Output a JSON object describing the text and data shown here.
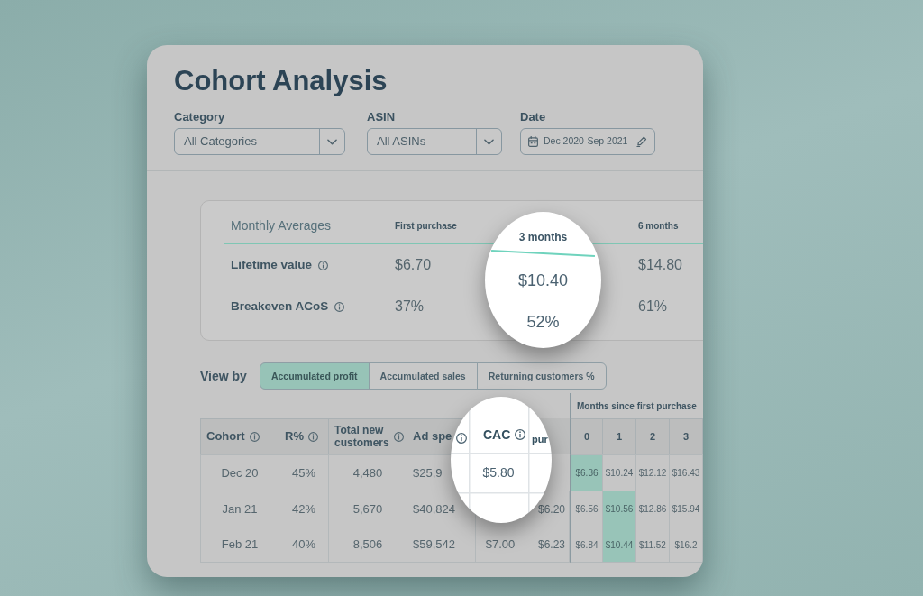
{
  "page": {
    "title": "Cohort Analysis"
  },
  "filters": [
    {
      "kind": "select",
      "label": "Category",
      "value": "All Categories"
    },
    {
      "kind": "select",
      "label": "ASIN",
      "value": "All ASINs"
    },
    {
      "kind": "date",
      "label": "Date",
      "value": "Dec 2020-Sep 2021"
    }
  ],
  "monthly_averages": {
    "title": "Monthly Averages",
    "columns": [
      {
        "label": "First purchase",
        "in_lens": false
      },
      {
        "label": "3 months",
        "in_lens": true
      },
      {
        "label": "6 months",
        "in_lens": false
      }
    ],
    "rows": [
      {
        "label": "Lifetime value",
        "info": true,
        "values": [
          "$6.70",
          "$10.40",
          "$14.80"
        ]
      },
      {
        "label": "Breakeven ACoS",
        "info": true,
        "values": [
          "37%",
          "52%",
          "61%"
        ]
      }
    ]
  },
  "view_by": {
    "label": "View by",
    "options": [
      {
        "label": "Accumulated profit",
        "selected": true
      },
      {
        "label": "Accumulated sales",
        "selected": false
      },
      {
        "label": "Returning customers %",
        "selected": false
      }
    ]
  },
  "cohort_table": {
    "columns": [
      {
        "label": "Cohort",
        "info": true
      },
      {
        "label": "R%",
        "info": true
      },
      {
        "label": "Total new customers",
        "info": true
      },
      {
        "label": "Ad spe",
        "info": true,
        "info_in_lens": true
      },
      {
        "label": "CAC",
        "info": true,
        "in_lens": true
      },
      {
        "label": "pur",
        "info": false,
        "in_lens": true
      }
    ],
    "month_group": "Months since first purchase",
    "months": [
      "0",
      "1",
      "2",
      "3"
    ],
    "rows": [
      {
        "cells": [
          "Dec 20",
          "45%",
          "4,480",
          "$25,9",
          {
            "value": "$5.80",
            "in_lens": true
          },
          null
        ],
        "months": [
          {
            "value": "$6.36",
            "highlight": true
          },
          {
            "value": "$10.24",
            "highlight": false
          },
          {
            "value": "$12.12",
            "highlight": false
          },
          {
            "value": "$16.43",
            "highlight": false
          }
        ]
      },
      {
        "cells": [
          "Jan 21",
          "42%",
          "5,670",
          "$40,824",
          null,
          "$6.20"
        ],
        "months": [
          {
            "value": "$6.56",
            "highlight": false
          },
          {
            "value": "$10.56",
            "highlight": true
          },
          {
            "value": "$12.86",
            "highlight": false
          },
          {
            "value": "$15.94",
            "highlight": false
          }
        ]
      },
      {
        "cells": [
          "Feb 21",
          "40%",
          "8,506",
          "$59,542",
          "$7.00",
          "$6.23"
        ],
        "months": [
          {
            "value": "$6.84",
            "highlight": false
          },
          {
            "value": "$10.44",
            "highlight": true
          },
          {
            "value": "$11.52",
            "highlight": false
          },
          {
            "value": "$16.2",
            "highlight": false
          }
        ]
      }
    ]
  }
}
